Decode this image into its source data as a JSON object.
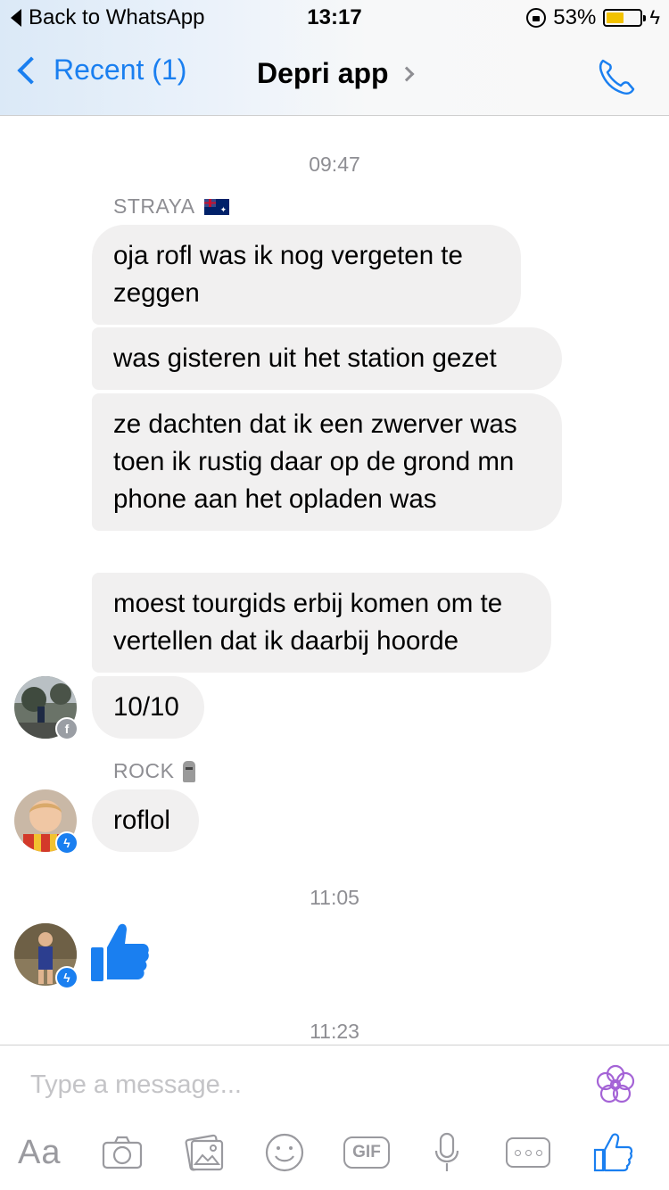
{
  "status_bar": {
    "back_app_label": "Back to WhatsApp",
    "time": "13:17",
    "battery_percent_label": "53%",
    "battery_level": 0.53,
    "battery_color": "#f2c200"
  },
  "nav": {
    "back_label": "Recent (1)",
    "title": "Depri app",
    "accent_color": "#1a7ff0",
    "call_icon": "phone-icon"
  },
  "conversation": {
    "first_timestamp": "09:47",
    "sender_straya": "STRAYA",
    "messages_straya": [
      "oja rofl was ik nog vergeten te zeggen",
      "was gisteren uit het station gezet",
      "ze dachten dat ik een zwerver was toen ik rustig daar op de grond mn phone aan het opladen was",
      "moest tourgids erbij komen om te vertellen dat ik daarbij hoorde",
      "10/10"
    ],
    "sender_rock": "ROCK",
    "message_rock": "roflol",
    "second_timestamp": "11:05",
    "third_timestamp": "11:23",
    "reaction_icon": "thumbs-up-icon"
  },
  "composer": {
    "placeholder": "Type a message...",
    "aa_label": "Aa",
    "gif_label": "GIF",
    "tools": [
      "camera-icon",
      "photo-icon",
      "emoji-icon",
      "gif-icon",
      "microphone-icon",
      "more-icon",
      "like-icon"
    ]
  }
}
